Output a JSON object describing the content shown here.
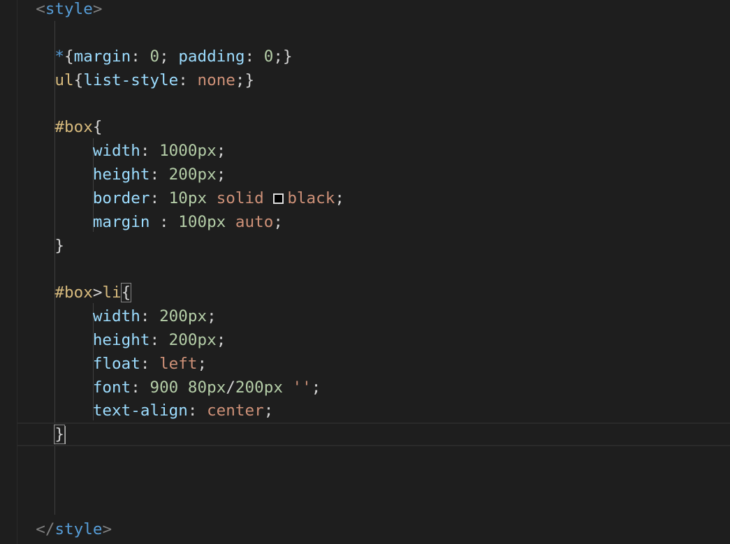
{
  "editor": {
    "language": "html",
    "lines": [
      {
        "indent": "  ",
        "tokens": [
          {
            "t": "<",
            "c": "tagbr"
          },
          {
            "t": "style",
            "c": "tag"
          },
          {
            "t": ">",
            "c": "tagbr"
          }
        ]
      },
      {
        "indent": "",
        "tokens": []
      },
      {
        "indent": "    ",
        "tokens": [
          {
            "t": "*",
            "c": "tag"
          },
          {
            "t": "{",
            "c": "punc"
          },
          {
            "t": "margin",
            "c": "prop"
          },
          {
            "t": ": ",
            "c": "punc"
          },
          {
            "t": "0",
            "c": "num"
          },
          {
            "t": "; ",
            "c": "punc"
          },
          {
            "t": "padding",
            "c": "prop"
          },
          {
            "t": ": ",
            "c": "punc"
          },
          {
            "t": "0",
            "c": "num"
          },
          {
            "t": ";}",
            "c": "punc"
          }
        ]
      },
      {
        "indent": "    ",
        "tokens": [
          {
            "t": "ul",
            "c": "sel"
          },
          {
            "t": "{",
            "c": "punc"
          },
          {
            "t": "list-style",
            "c": "prop"
          },
          {
            "t": ": ",
            "c": "punc"
          },
          {
            "t": "none",
            "c": "val"
          },
          {
            "t": ";}",
            "c": "punc"
          }
        ]
      },
      {
        "indent": "",
        "tokens": []
      },
      {
        "indent": "    ",
        "tokens": [
          {
            "t": "#box",
            "c": "sel"
          },
          {
            "t": "{",
            "c": "punc"
          }
        ]
      },
      {
        "indent": "        ",
        "tokens": [
          {
            "t": "width",
            "c": "prop"
          },
          {
            "t": ": ",
            "c": "punc"
          },
          {
            "t": "1000px",
            "c": "num"
          },
          {
            "t": ";",
            "c": "punc"
          }
        ]
      },
      {
        "indent": "        ",
        "tokens": [
          {
            "t": "height",
            "c": "prop"
          },
          {
            "t": ": ",
            "c": "punc"
          },
          {
            "t": "200px",
            "c": "num"
          },
          {
            "t": ";",
            "c": "punc"
          }
        ]
      },
      {
        "indent": "        ",
        "tokens": [
          {
            "t": "border",
            "c": "prop"
          },
          {
            "t": ": ",
            "c": "punc"
          },
          {
            "t": "10px",
            "c": "num"
          },
          {
            "t": " ",
            "c": "punc"
          },
          {
            "t": "solid",
            "c": "val"
          },
          {
            "t": " ",
            "c": "punc"
          },
          {
            "t": "",
            "c": "swatch",
            "color": "#000000"
          },
          {
            "t": "black",
            "c": "val"
          },
          {
            "t": ";",
            "c": "punc"
          }
        ]
      },
      {
        "indent": "        ",
        "tokens": [
          {
            "t": "margin",
            "c": "prop"
          },
          {
            "t": " : ",
            "c": "punc"
          },
          {
            "t": "100px",
            "c": "num"
          },
          {
            "t": " ",
            "c": "punc"
          },
          {
            "t": "auto",
            "c": "val"
          },
          {
            "t": ";",
            "c": "punc"
          }
        ]
      },
      {
        "indent": "    ",
        "tokens": [
          {
            "t": "}",
            "c": "punc"
          }
        ]
      },
      {
        "indent": "",
        "tokens": []
      },
      {
        "indent": "    ",
        "tokens": [
          {
            "t": "#box",
            "c": "sel"
          },
          {
            "t": ">",
            "c": "punc"
          },
          {
            "t": "li",
            "c": "sel"
          },
          {
            "t": "{",
            "c": "punc",
            "match": true
          }
        ]
      },
      {
        "indent": "        ",
        "tokens": [
          {
            "t": "width",
            "c": "prop"
          },
          {
            "t": ": ",
            "c": "punc"
          },
          {
            "t": "200px",
            "c": "num"
          },
          {
            "t": ";",
            "c": "punc"
          }
        ]
      },
      {
        "indent": "        ",
        "tokens": [
          {
            "t": "height",
            "c": "prop"
          },
          {
            "t": ": ",
            "c": "punc"
          },
          {
            "t": "200px",
            "c": "num"
          },
          {
            "t": ";",
            "c": "punc"
          }
        ]
      },
      {
        "indent": "        ",
        "tokens": [
          {
            "t": "float",
            "c": "prop"
          },
          {
            "t": ": ",
            "c": "punc"
          },
          {
            "t": "left",
            "c": "val"
          },
          {
            "t": ";",
            "c": "punc"
          }
        ]
      },
      {
        "indent": "        ",
        "tokens": [
          {
            "t": "font",
            "c": "prop"
          },
          {
            "t": ": ",
            "c": "punc"
          },
          {
            "t": "900",
            "c": "num"
          },
          {
            "t": " ",
            "c": "punc"
          },
          {
            "t": "80px",
            "c": "num"
          },
          {
            "t": "/",
            "c": "punc"
          },
          {
            "t": "200px",
            "c": "num"
          },
          {
            "t": " ",
            "c": "punc"
          },
          {
            "t": "''",
            "c": "val"
          },
          {
            "t": ";",
            "c": "punc"
          }
        ]
      },
      {
        "indent": "        ",
        "tokens": [
          {
            "t": "text-align",
            "c": "prop"
          },
          {
            "t": ": ",
            "c": "punc"
          },
          {
            "t": "center",
            "c": "val"
          },
          {
            "t": ";",
            "c": "punc"
          }
        ]
      },
      {
        "indent": "    ",
        "current": true,
        "tokens": [
          {
            "t": "}",
            "c": "punc",
            "match": true
          },
          {
            "t": "",
            "c": "cursor"
          }
        ]
      },
      {
        "indent": "",
        "tokens": []
      },
      {
        "indent": "",
        "tokens": []
      },
      {
        "indent": "",
        "tokens": []
      },
      {
        "indent": "  ",
        "tokens": [
          {
            "t": "</",
            "c": "tagbr"
          },
          {
            "t": "style",
            "c": "tag"
          },
          {
            "t": ">",
            "c": "tagbr"
          }
        ]
      }
    ]
  }
}
